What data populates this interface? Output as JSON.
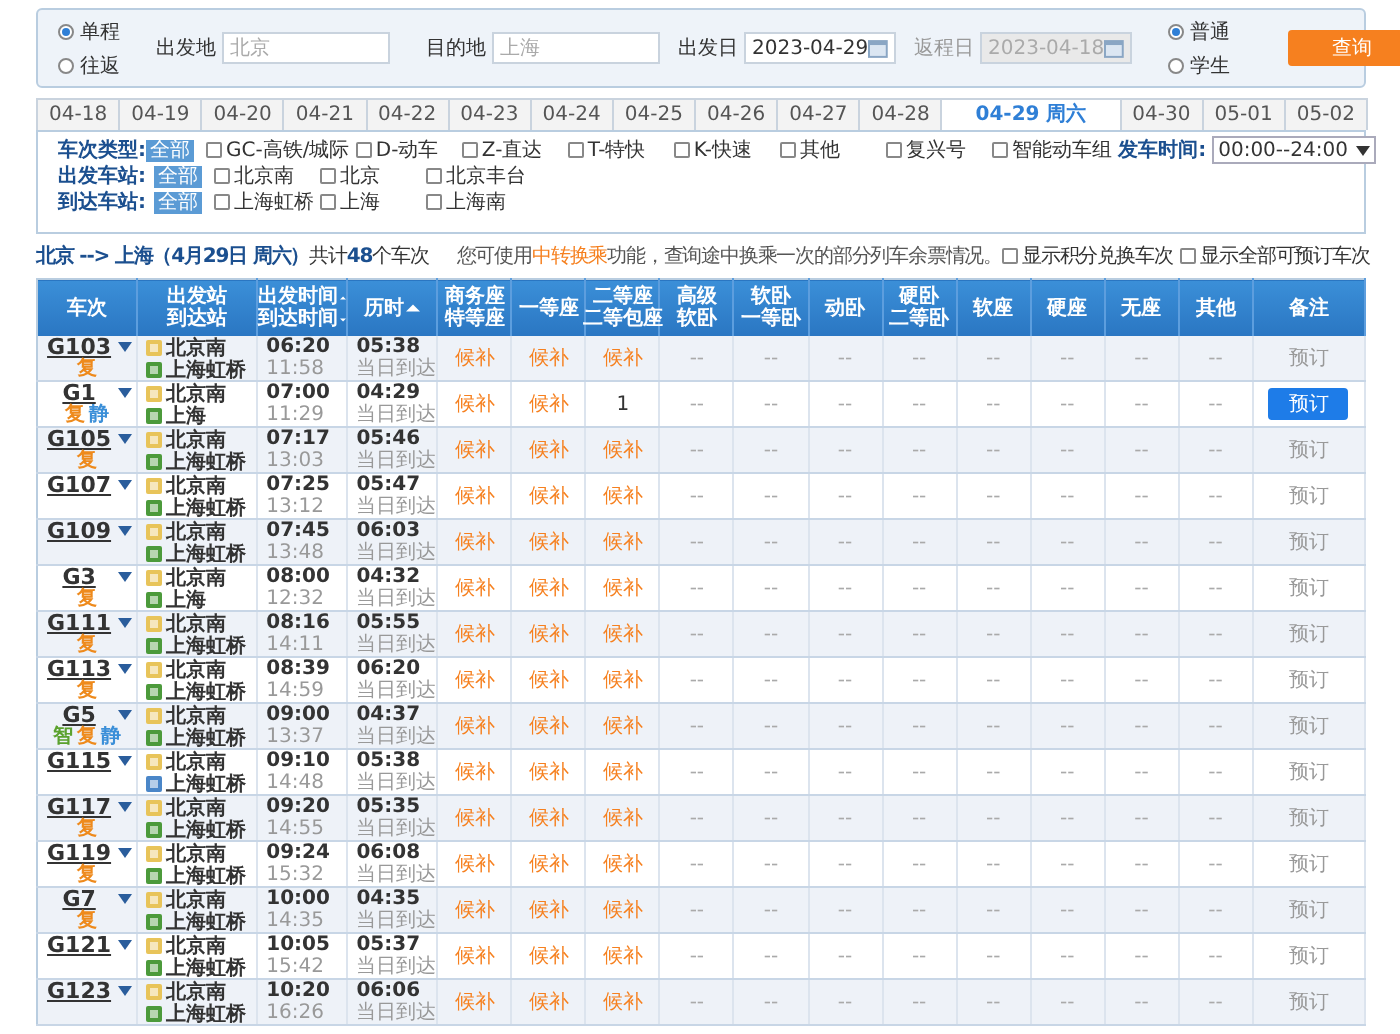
{
  "search": {
    "trip_type": [
      {
        "label": "单程",
        "selected": true
      },
      {
        "label": "往返",
        "selected": false
      }
    ],
    "fields": [
      {
        "kind": "station",
        "label": "出发地",
        "placeholder": "北京",
        "disabled": false
      },
      {
        "kind": "station",
        "label": "目的地",
        "placeholder": "上海",
        "disabled": false
      },
      {
        "kind": "date",
        "label": "出发日",
        "value": "2023-04-29",
        "disabled": false
      },
      {
        "kind": "date",
        "label": "返程日",
        "value": "2023-04-18",
        "disabled": true
      }
    ],
    "passenger_type": [
      {
        "label": "普通",
        "selected": true
      },
      {
        "label": "学生",
        "selected": false
      }
    ],
    "query_button": "查询"
  },
  "date_tabs": [
    {
      "label": "04-18",
      "selected": false
    },
    {
      "label": "04-19",
      "selected": false
    },
    {
      "label": "04-20",
      "selected": false
    },
    {
      "label": "04-21",
      "selected": false
    },
    {
      "label": "04-22",
      "selected": false
    },
    {
      "label": "04-23",
      "selected": false
    },
    {
      "label": "04-24",
      "selected": false
    },
    {
      "label": "04-25",
      "selected": false
    },
    {
      "label": "04-26",
      "selected": false
    },
    {
      "label": "04-27",
      "selected": false
    },
    {
      "label": "04-28",
      "selected": false
    },
    {
      "label": "04-29 周六",
      "selected": true
    },
    {
      "label": "04-30",
      "selected": false
    },
    {
      "label": "05-01",
      "selected": false
    },
    {
      "label": "05-02",
      "selected": false
    }
  ],
  "filters": [
    {
      "label": "车次类型:",
      "all": "全部",
      "options": [
        {
          "label": "GC-高铁/城际",
          "checked": false
        },
        {
          "label": "D-动车",
          "checked": false
        },
        {
          "label": "Z-直达",
          "checked": false
        },
        {
          "label": "T-特快",
          "checked": false
        },
        {
          "label": "K-快速",
          "checked": false
        },
        {
          "label": "其他",
          "checked": false
        },
        {
          "label": "复兴号",
          "checked": false
        },
        {
          "label": "智能动车组",
          "checked": false
        }
      ]
    },
    {
      "label": "出发车站:",
      "all": "全部",
      "options": [
        {
          "label": "北京南",
          "checked": false
        },
        {
          "label": "北京",
          "checked": false
        },
        {
          "label": "北京丰台",
          "checked": false
        }
      ]
    },
    {
      "label": "到达车站:",
      "all": "全部",
      "options": [
        {
          "label": "上海虹桥",
          "checked": false
        },
        {
          "label": "上海",
          "checked": false
        },
        {
          "label": "上海南",
          "checked": false
        }
      ]
    }
  ],
  "departure_time": {
    "label": "发车时间:",
    "value": "00:00--24:00"
  },
  "summary": {
    "route": "**北京 --> 上海（4月29日 周六）**共计**48**个车次",
    "notice_before": "您可使用",
    "notice_link": "中转换乘",
    "notice_after": "功能，查询途中换乘一次的部分列车余票情况。",
    "options": [
      {
        "label": "显示积分兑换车次",
        "checked": false
      },
      {
        "label": "显示全部可预订车次",
        "checked": false
      }
    ]
  },
  "table": {
    "columns": [
      {
        "lines": [
          "车次"
        ]
      },
      {
        "lines": [
          "出发站",
          "到达站"
        ]
      },
      {
        "lines": [
          "出发时间",
          "到达时间"
        ],
        "sort_descending": [
          false,
          true
        ]
      },
      {
        "lines": [
          "历时"
        ],
        "sort_descending": [
          false
        ]
      },
      {
        "lines": [
          "商务座",
          "特等座"
        ]
      },
      {
        "lines": [
          "一等座"
        ]
      },
      {
        "lines": [
          "二等座",
          "二等包座"
        ]
      },
      {
        "lines": [
          "高级",
          "软卧"
        ]
      },
      {
        "lines": [
          "软卧",
          "一等卧"
        ]
      },
      {
        "lines": [
          "动卧"
        ]
      },
      {
        "lines": [
          "硬卧",
          "二等卧"
        ]
      },
      {
        "lines": [
          "软座"
        ]
      },
      {
        "lines": [
          "硬座"
        ]
      },
      {
        "lines": [
          "无座"
        ]
      },
      {
        "lines": [
          "其他"
        ]
      },
      {
        "lines": [
          "备注"
        ]
      }
    ],
    "rows": [
      {
        "train": "G103",
        "tags": [
          {
            "label": "复",
            "color": "#ee8a1c"
          }
        ],
        "from": "北京南",
        "to": "上海虹桥",
        "arrival_passing": false,
        "depart": "06:20",
        "arrive": "11:58",
        "duration": "05:38",
        "arrival_day": "当日到达",
        "seats": [
          {
            "value": "候补",
            "kind": "waitlist"
          },
          {
            "value": "候补",
            "kind": "waitlist"
          },
          {
            "value": "候补",
            "kind": "waitlist"
          },
          {
            "value": "--",
            "kind": "none"
          },
          {
            "value": "--",
            "kind": "none"
          },
          {
            "value": "--",
            "kind": "none"
          },
          {
            "value": "--",
            "kind": "none"
          },
          {
            "value": "--",
            "kind": "none"
          },
          {
            "value": "--",
            "kind": "none"
          },
          {
            "value": "--",
            "kind": "none"
          },
          {
            "value": "--",
            "kind": "none"
          }
        ],
        "book": {
          "label": "预订",
          "active": false
        }
      },
      {
        "train": "G1",
        "tags": [
          {
            "label": "复",
            "color": "#ee8a1c"
          },
          {
            "label": "静",
            "color": "#3b8fd8"
          }
        ],
        "from": "北京南",
        "to": "上海",
        "arrival_passing": false,
        "depart": "07:00",
        "arrive": "11:29",
        "duration": "04:29",
        "arrival_day": "当日到达",
        "seats": [
          {
            "value": "候补",
            "kind": "waitlist"
          },
          {
            "value": "候补",
            "kind": "waitlist"
          },
          {
            "value": "1",
            "kind": "count"
          },
          {
            "value": "--",
            "kind": "none"
          },
          {
            "value": "--",
            "kind": "none"
          },
          {
            "value": "--",
            "kind": "none"
          },
          {
            "value": "--",
            "kind": "none"
          },
          {
            "value": "--",
            "kind": "none"
          },
          {
            "value": "--",
            "kind": "none"
          },
          {
            "value": "--",
            "kind": "none"
          },
          {
            "value": "--",
            "kind": "none"
          }
        ],
        "book": {
          "label": "预订",
          "active": true
        }
      },
      {
        "train": "G105",
        "tags": [
          {
            "label": "复",
            "color": "#ee8a1c"
          }
        ],
        "from": "北京南",
        "to": "上海虹桥",
        "arrival_passing": false,
        "depart": "07:17",
        "arrive": "13:03",
        "duration": "05:46",
        "arrival_day": "当日到达",
        "seats": [
          {
            "value": "候补",
            "kind": "waitlist"
          },
          {
            "value": "候补",
            "kind": "waitlist"
          },
          {
            "value": "候补",
            "kind": "waitlist"
          },
          {
            "value": "--",
            "kind": "none"
          },
          {
            "value": "--",
            "kind": "none"
          },
          {
            "value": "--",
            "kind": "none"
          },
          {
            "value": "--",
            "kind": "none"
          },
          {
            "value": "--",
            "kind": "none"
          },
          {
            "value": "--",
            "kind": "none"
          },
          {
            "value": "--",
            "kind": "none"
          },
          {
            "value": "--",
            "kind": "none"
          }
        ],
        "book": {
          "label": "预订",
          "active": false
        }
      },
      {
        "train": "G107",
        "tags": [],
        "from": "北京南",
        "to": "上海虹桥",
        "arrival_passing": false,
        "depart": "07:25",
        "arrive": "13:12",
        "duration": "05:47",
        "arrival_day": "当日到达",
        "seats": [
          {
            "value": "候补",
            "kind": "waitlist"
          },
          {
            "value": "候补",
            "kind": "waitlist"
          },
          {
            "value": "候补",
            "kind": "waitlist"
          },
          {
            "value": "--",
            "kind": "none"
          },
          {
            "value": "--",
            "kind": "none"
          },
          {
            "value": "--",
            "kind": "none"
          },
          {
            "value": "--",
            "kind": "none"
          },
          {
            "value": "--",
            "kind": "none"
          },
          {
            "value": "--",
            "kind": "none"
          },
          {
            "value": "--",
            "kind": "none"
          },
          {
            "value": "--",
            "kind": "none"
          }
        ],
        "book": {
          "label": "预订",
          "active": false
        }
      },
      {
        "train": "G109",
        "tags": [],
        "from": "北京南",
        "to": "上海虹桥",
        "arrival_passing": false,
        "depart": "07:45",
        "arrive": "13:48",
        "duration": "06:03",
        "arrival_day": "当日到达",
        "seats": [
          {
            "value": "候补",
            "kind": "waitlist"
          },
          {
            "value": "候补",
            "kind": "waitlist"
          },
          {
            "value": "候补",
            "kind": "waitlist"
          },
          {
            "value": "--",
            "kind": "none"
          },
          {
            "value": "--",
            "kind": "none"
          },
          {
            "value": "--",
            "kind": "none"
          },
          {
            "value": "--",
            "kind": "none"
          },
          {
            "value": "--",
            "kind": "none"
          },
          {
            "value": "--",
            "kind": "none"
          },
          {
            "value": "--",
            "kind": "none"
          },
          {
            "value": "--",
            "kind": "none"
          }
        ],
        "book": {
          "label": "预订",
          "active": false
        }
      },
      {
        "train": "G3",
        "tags": [
          {
            "label": "复",
            "color": "#ee8a1c"
          }
        ],
        "from": "北京南",
        "to": "上海",
        "arrival_passing": false,
        "depart": "08:00",
        "arrive": "12:32",
        "duration": "04:32",
        "arrival_day": "当日到达",
        "seats": [
          {
            "value": "候补",
            "kind": "waitlist"
          },
          {
            "value": "候补",
            "kind": "waitlist"
          },
          {
            "value": "候补",
            "kind": "waitlist"
          },
          {
            "value": "--",
            "kind": "none"
          },
          {
            "value": "--",
            "kind": "none"
          },
          {
            "value": "--",
            "kind": "none"
          },
          {
            "value": "--",
            "kind": "none"
          },
          {
            "value": "--",
            "kind": "none"
          },
          {
            "value": "--",
            "kind": "none"
          },
          {
            "value": "--",
            "kind": "none"
          },
          {
            "value": "--",
            "kind": "none"
          }
        ],
        "book": {
          "label": "预订",
          "active": false
        }
      },
      {
        "train": "G111",
        "tags": [
          {
            "label": "复",
            "color": "#ee8a1c"
          }
        ],
        "from": "北京南",
        "to": "上海虹桥",
        "arrival_passing": false,
        "depart": "08:16",
        "arrive": "14:11",
        "duration": "05:55",
        "arrival_day": "当日到达",
        "seats": [
          {
            "value": "候补",
            "kind": "waitlist"
          },
          {
            "value": "候补",
            "kind": "waitlist"
          },
          {
            "value": "候补",
            "kind": "waitlist"
          },
          {
            "value": "--",
            "kind": "none"
          },
          {
            "value": "--",
            "kind": "none"
          },
          {
            "value": "--",
            "kind": "none"
          },
          {
            "value": "--",
            "kind": "none"
          },
          {
            "value": "--",
            "kind": "none"
          },
          {
            "value": "--",
            "kind": "none"
          },
          {
            "value": "--",
            "kind": "none"
          },
          {
            "value": "--",
            "kind": "none"
          }
        ],
        "book": {
          "label": "预订",
          "active": false
        }
      },
      {
        "train": "G113",
        "tags": [
          {
            "label": "复",
            "color": "#ee8a1c"
          }
        ],
        "from": "北京南",
        "to": "上海虹桥",
        "arrival_passing": false,
        "depart": "08:39",
        "arrive": "14:59",
        "duration": "06:20",
        "arrival_day": "当日到达",
        "seats": [
          {
            "value": "候补",
            "kind": "waitlist"
          },
          {
            "value": "候补",
            "kind": "waitlist"
          },
          {
            "value": "候补",
            "kind": "waitlist"
          },
          {
            "value": "--",
            "kind": "none"
          },
          {
            "value": "--",
            "kind": "none"
          },
          {
            "value": "--",
            "kind": "none"
          },
          {
            "value": "--",
            "kind": "none"
          },
          {
            "value": "--",
            "kind": "none"
          },
          {
            "value": "--",
            "kind": "none"
          },
          {
            "value": "--",
            "kind": "none"
          },
          {
            "value": "--",
            "kind": "none"
          }
        ],
        "book": {
          "label": "预订",
          "active": false
        }
      },
      {
        "train": "G5",
        "tags": [
          {
            "label": "智",
            "color": "#5ba22e"
          },
          {
            "label": "复",
            "color": "#ee8a1c"
          },
          {
            "label": "静",
            "color": "#3b8fd8"
          }
        ],
        "from": "北京南",
        "to": "上海虹桥",
        "arrival_passing": false,
        "depart": "09:00",
        "arrive": "13:37",
        "duration": "04:37",
        "arrival_day": "当日到达",
        "seats": [
          {
            "value": "候补",
            "kind": "waitlist"
          },
          {
            "value": "候补",
            "kind": "waitlist"
          },
          {
            "value": "候补",
            "kind": "waitlist"
          },
          {
            "value": "--",
            "kind": "none"
          },
          {
            "value": "--",
            "kind": "none"
          },
          {
            "value": "--",
            "kind": "none"
          },
          {
            "value": "--",
            "kind": "none"
          },
          {
            "value": "--",
            "kind": "none"
          },
          {
            "value": "--",
            "kind": "none"
          },
          {
            "value": "--",
            "kind": "none"
          },
          {
            "value": "--",
            "kind": "none"
          }
        ],
        "book": {
          "label": "预订",
          "active": false
        }
      },
      {
        "train": "G115",
        "tags": [],
        "from": "北京南",
        "to": "上海虹桥",
        "arrival_passing": true,
        "depart": "09:10",
        "arrive": "14:48",
        "duration": "05:38",
        "arrival_day": "当日到达",
        "seats": [
          {
            "value": "候补",
            "kind": "waitlist"
          },
          {
            "value": "候补",
            "kind": "waitlist"
          },
          {
            "value": "候补",
            "kind": "waitlist"
          },
          {
            "value": "--",
            "kind": "none"
          },
          {
            "value": "--",
            "kind": "none"
          },
          {
            "value": "--",
            "kind": "none"
          },
          {
            "value": "--",
            "kind": "none"
          },
          {
            "value": "--",
            "kind": "none"
          },
          {
            "value": "--",
            "kind": "none"
          },
          {
            "value": "--",
            "kind": "none"
          },
          {
            "value": "--",
            "kind": "none"
          }
        ],
        "book": {
          "label": "预订",
          "active": false
        }
      },
      {
        "train": "G117",
        "tags": [
          {
            "label": "复",
            "color": "#ee8a1c"
          }
        ],
        "from": "北京南",
        "to": "上海虹桥",
        "arrival_passing": false,
        "depart": "09:20",
        "arrive": "14:55",
        "duration": "05:35",
        "arrival_day": "当日到达",
        "seats": [
          {
            "value": "候补",
            "kind": "waitlist"
          },
          {
            "value": "候补",
            "kind": "waitlist"
          },
          {
            "value": "候补",
            "kind": "waitlist"
          },
          {
            "value": "--",
            "kind": "none"
          },
          {
            "value": "--",
            "kind": "none"
          },
          {
            "value": "--",
            "kind": "none"
          },
          {
            "value": "--",
            "kind": "none"
          },
          {
            "value": "--",
            "kind": "none"
          },
          {
            "value": "--",
            "kind": "none"
          },
          {
            "value": "--",
            "kind": "none"
          },
          {
            "value": "--",
            "kind": "none"
          }
        ],
        "book": {
          "label": "预订",
          "active": false
        }
      },
      {
        "train": "G119",
        "tags": [
          {
            "label": "复",
            "color": "#ee8a1c"
          }
        ],
        "from": "北京南",
        "to": "上海虹桥",
        "arrival_passing": false,
        "depart": "09:24",
        "arrive": "15:32",
        "duration": "06:08",
        "arrival_day": "当日到达",
        "seats": [
          {
            "value": "候补",
            "kind": "waitlist"
          },
          {
            "value": "候补",
            "kind": "waitlist"
          },
          {
            "value": "候补",
            "kind": "waitlist"
          },
          {
            "value": "--",
            "kind": "none"
          },
          {
            "value": "--",
            "kind": "none"
          },
          {
            "value": "--",
            "kind": "none"
          },
          {
            "value": "--",
            "kind": "none"
          },
          {
            "value": "--",
            "kind": "none"
          },
          {
            "value": "--",
            "kind": "none"
          },
          {
            "value": "--",
            "kind": "none"
          },
          {
            "value": "--",
            "kind": "none"
          }
        ],
        "book": {
          "label": "预订",
          "active": false
        }
      },
      {
        "train": "G7",
        "tags": [
          {
            "label": "复",
            "color": "#ee8a1c"
          }
        ],
        "from": "北京南",
        "to": "上海虹桥",
        "arrival_passing": false,
        "depart": "10:00",
        "arrive": "14:35",
        "duration": "04:35",
        "arrival_day": "当日到达",
        "seats": [
          {
            "value": "候补",
            "kind": "waitlist"
          },
          {
            "value": "候补",
            "kind": "waitlist"
          },
          {
            "value": "候补",
            "kind": "waitlist"
          },
          {
            "value": "--",
            "kind": "none"
          },
          {
            "value": "--",
            "kind": "none"
          },
          {
            "value": "--",
            "kind": "none"
          },
          {
            "value": "--",
            "kind": "none"
          },
          {
            "value": "--",
            "kind": "none"
          },
          {
            "value": "--",
            "kind": "none"
          },
          {
            "value": "--",
            "kind": "none"
          },
          {
            "value": "--",
            "kind": "none"
          }
        ],
        "book": {
          "label": "预订",
          "active": false
        }
      },
      {
        "train": "G121",
        "tags": [],
        "from": "北京南",
        "to": "上海虹桥",
        "arrival_passing": false,
        "depart": "10:05",
        "arrive": "15:42",
        "duration": "05:37",
        "arrival_day": "当日到达",
        "seats": [
          {
            "value": "候补",
            "kind": "waitlist"
          },
          {
            "value": "候补",
            "kind": "waitlist"
          },
          {
            "value": "候补",
            "kind": "waitlist"
          },
          {
            "value": "--",
            "kind": "none"
          },
          {
            "value": "--",
            "kind": "none"
          },
          {
            "value": "--",
            "kind": "none"
          },
          {
            "value": "--",
            "kind": "none"
          },
          {
            "value": "--",
            "kind": "none"
          },
          {
            "value": "--",
            "kind": "none"
          },
          {
            "value": "--",
            "kind": "none"
          },
          {
            "value": "--",
            "kind": "none"
          }
        ],
        "book": {
          "label": "预订",
          "active": false
        }
      },
      {
        "train": "G123",
        "tags": [],
        "from": "北京南",
        "to": "上海虹桥",
        "arrival_passing": false,
        "depart": "10:20",
        "arrive": "16:26",
        "duration": "06:06",
        "arrival_day": "当日到达",
        "seats": [
          {
            "value": "候补",
            "kind": "waitlist"
          },
          {
            "value": "候补",
            "kind": "waitlist"
          },
          {
            "value": "候补",
            "kind": "waitlist"
          },
          {
            "value": "--",
            "kind": "none"
          },
          {
            "value": "--",
            "kind": "none"
          },
          {
            "value": "--",
            "kind": "none"
          },
          {
            "value": "--",
            "kind": "none"
          },
          {
            "value": "--",
            "kind": "none"
          },
          {
            "value": "--",
            "kind": "none"
          },
          {
            "value": "--",
            "kind": "none"
          },
          {
            "value": "--",
            "kind": "none"
          }
        ],
        "book": {
          "label": "预订",
          "active": false
        }
      }
    ]
  }
}
